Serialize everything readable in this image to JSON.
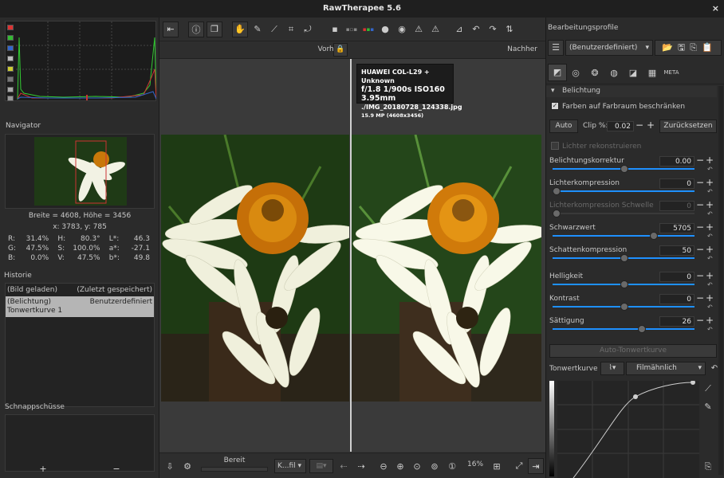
{
  "window": {
    "title": "RawTherapee 5.6",
    "close": "×"
  },
  "navigator": {
    "title": "Navigator",
    "size_label": "Breite = 4608, Höhe = 3456",
    "coords": "x: 3783, y: 785",
    "readouts": [
      [
        "R:",
        "31.4%",
        "H:",
        "80.3°",
        "L*:",
        "46.3"
      ],
      [
        "G:",
        "47.5%",
        "S:",
        "100.0%",
        "a*:",
        "-27.1"
      ],
      [
        "B:",
        "0.0%",
        "V:",
        "47.5%",
        "b*:",
        "49.8"
      ]
    ]
  },
  "history": {
    "title": "Historie",
    "rows": [
      {
        "a": "(Bild geladen)",
        "b": "(Zuletzt gespeichert)"
      },
      {
        "a": "(Belichtung)\nTonwertkurve 1",
        "b": "Benutzerdefiniert"
      }
    ]
  },
  "snapshots": {
    "title": "Schnappschüsse",
    "add": "+",
    "remove": "−"
  },
  "viewer": {
    "before": "Vorher",
    "after": "Nachher",
    "info": {
      "line1": "HUAWEI COL-L29 + Unknown",
      "line2": "f/1.8 1/900s ISO160 3.95mm",
      "line3": "./IMG_20180728_124338.jpg",
      "line4": "15.9 MP (4608x3456)"
    }
  },
  "statusbar": {
    "status": "Bereit",
    "profile_combo": "K...fil",
    "zoom": "16%"
  },
  "profiles": {
    "title": "Bearbeitungsprofile",
    "selected": "(Benutzerdefiniert)"
  },
  "exposure": {
    "section": "Belichtung",
    "checkbox": "Farben auf Farbraum beschränken",
    "auto": "Auto",
    "clip_label": "Clip %:",
    "clip_value": "0.02",
    "reset": "Zurücksetzen",
    "reconstruct": "Lichter rekonstruieren",
    "sliders": [
      {
        "label": "Belichtungskorrektur",
        "value": "0.00",
        "level": 0.5
      },
      {
        "label": "Lichterkompression",
        "value": "0",
        "level": 0.0
      },
      {
        "label": "Lichterkompression Schwelle",
        "value": "0",
        "level": 0.0,
        "disabled": true
      },
      {
        "label": "Schwarzwert",
        "value": "5705",
        "level": 0.72
      },
      {
        "label": "Schattenkompression",
        "value": "50",
        "level": 0.5
      },
      {
        "label": "Helligkeit",
        "value": "0",
        "level": 0.5
      },
      {
        "label": "Kontrast",
        "value": "0",
        "level": 0.5
      },
      {
        "label": "Sättigung",
        "value": "26",
        "level": 0.63
      }
    ],
    "auto_curve": "Auto-Tonwertkurve",
    "curve_label": "Tonwertkurve 1:",
    "curve_mode": "Filmähnlich"
  },
  "colors": {
    "accent": "#1e90ff",
    "bg": "#2e2e2e"
  }
}
